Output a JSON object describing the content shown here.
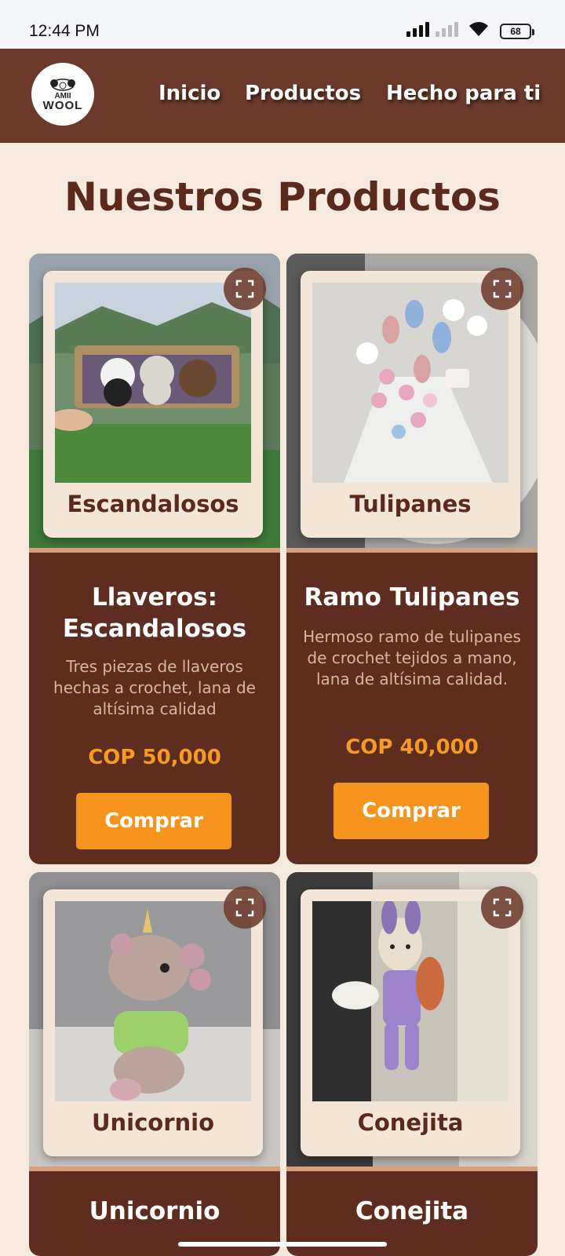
{
  "status": {
    "time": "12:44 PM",
    "battery": "68"
  },
  "header": {
    "logo_top": "AMII",
    "logo_bottom": "WOOL",
    "nav": [
      "Inicio",
      "Productos",
      "Hecho para ti"
    ]
  },
  "page": {
    "title": "Nuestros Productos"
  },
  "products": [
    {
      "caption": "Escandalosos",
      "name": "Llaveros: Escandalosos",
      "description": "Tres piezas de llaveros hechas a crochet, lana de altísima calidad",
      "price": "COP 50,000",
      "button": "Comprar"
    },
    {
      "caption": "Tulipanes",
      "name": "Ramo Tulipanes",
      "description": "Hermoso ramo de tulipanes de crochet tejidos a mano, lana de altísima calidad.",
      "price": "COP 40,000",
      "button": "Comprar"
    },
    {
      "caption": "Unicornio",
      "name": "Unicornio"
    },
    {
      "caption": "Conejita",
      "name": "Conejita"
    }
  ],
  "colors": {
    "header_bg": "#6b3a2b",
    "card_bg": "#5e2d1f",
    "accent": "#f7941d",
    "page_bg": "#f6e9dd"
  }
}
